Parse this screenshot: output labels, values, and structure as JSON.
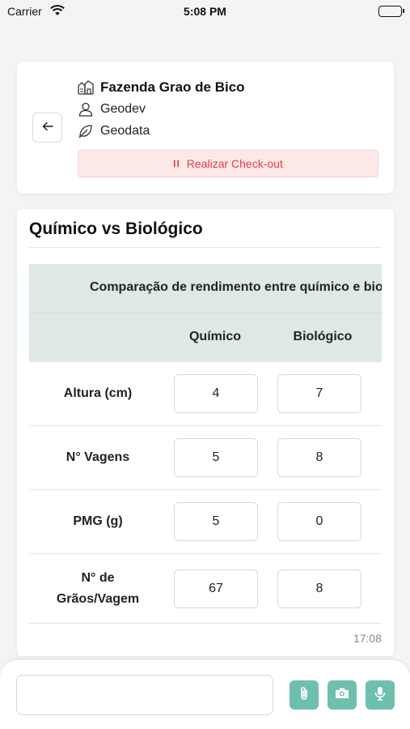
{
  "status_bar": {
    "carrier": "Carrier",
    "time": "5:08 PM"
  },
  "header": {
    "farm_name": "Fazenda Grao de Bico",
    "user_name": "Geodev",
    "dataset": "Geodata",
    "checkout_label": "Realizar Check-out",
    "checkout_icon": "II",
    "checkout_color": "#e53e3e"
  },
  "message": {
    "title": "Químico vs Biológico",
    "caption": "Comparação de rendimento entre químico e biológico",
    "columns": [
      "Químico",
      "Biológico"
    ],
    "rows": [
      {
        "label": "Altura (cm)",
        "quimico": "4",
        "biologico": "7"
      },
      {
        "label": "N° Vagens",
        "quimico": "5",
        "biologico": "8"
      },
      {
        "label": "PMG (g)",
        "quimico": "5",
        "biologico": "0"
      },
      {
        "label": "N° de Grãos/Vagem",
        "quimico": "67",
        "biologico": "8"
      }
    ],
    "time": "17:08"
  },
  "composer": {
    "placeholder": "",
    "accent": "#6fbfae"
  },
  "icons": {
    "back": "arrow-left-icon",
    "farm": "farm-icon",
    "user": "user-icon",
    "data": "leaf-icon",
    "attach": "paperclip-icon",
    "camera": "camera-icon",
    "mic": "microphone-icon"
  }
}
